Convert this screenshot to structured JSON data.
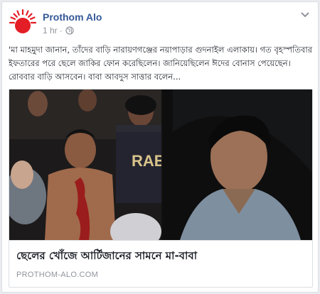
{
  "post": {
    "page_name": "Prothom Alo",
    "time": "1 hr",
    "dot": "·",
    "body": "'মা মাহমুদা জানান, তাঁদের বাড়ি নারায়ণগঞ্জের নয়াপাড়ার গুদনাইল এলাকায়। গত বৃহস্পতিবার ইফতারের পরে ছেলে জাকির ফোন করেছিলেন। জানিয়েছিলেন ঈদের বোনাস পেয়েছেন। রোববার বাড়ি আসবেন। বাবা আবদুস সাত্তার বলেন...",
    "link": {
      "title": "ছেলের খোঁজে আর্টিজানের সামনে মা-বাবা",
      "domain": "PROTHOM-ALO.COM",
      "photo_text_left": "RAB"
    }
  },
  "colors": {
    "brand_red": "#e41e26",
    "link_blue": "#365899",
    "meta_gray": "#90949c"
  },
  "icons": [
    "prothom-alo-logo",
    "globe-icon",
    "chevron-down-icon"
  ]
}
